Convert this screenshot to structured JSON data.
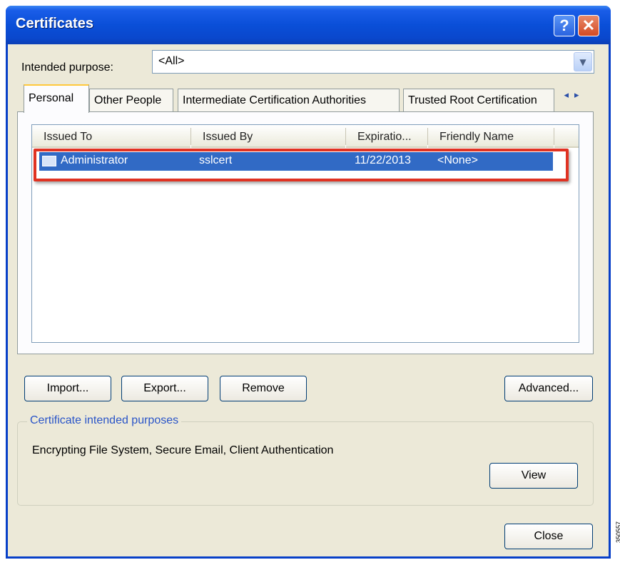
{
  "window": {
    "title": "Certificates",
    "help_label": "?",
    "close_label": "✕"
  },
  "purpose": {
    "label": "Intended purpose:",
    "value": "<All>"
  },
  "tabs": [
    {
      "label": "Personal"
    },
    {
      "label": "Other People"
    },
    {
      "label": "Intermediate Certification Authorities"
    },
    {
      "label": "Trusted Root Certification"
    }
  ],
  "tab_scroll": {
    "left": "◂",
    "right": "▸"
  },
  "list": {
    "columns": [
      "Issued To",
      "Issued By",
      "Expiratio...",
      "Friendly Name"
    ],
    "rows": [
      {
        "issued_to": "Administrator",
        "issued_by": "sslcert",
        "expiration": "11/22/2013",
        "friendly_name": "<None>"
      }
    ]
  },
  "buttons": {
    "import": "Import...",
    "export": "Export...",
    "remove": "Remove",
    "advanced": "Advanced...",
    "view": "View",
    "close": "Close"
  },
  "purposes_group": {
    "title": "Certificate intended purposes",
    "text": "Encrypting File System, Secure Email, Client Authentication"
  },
  "watermark": "350557",
  "colors": {
    "titlebar": "#0a4fd8",
    "selection": "#316ac5",
    "highlight_box": "#e03222",
    "dialog_bg": "#ece9d8"
  }
}
